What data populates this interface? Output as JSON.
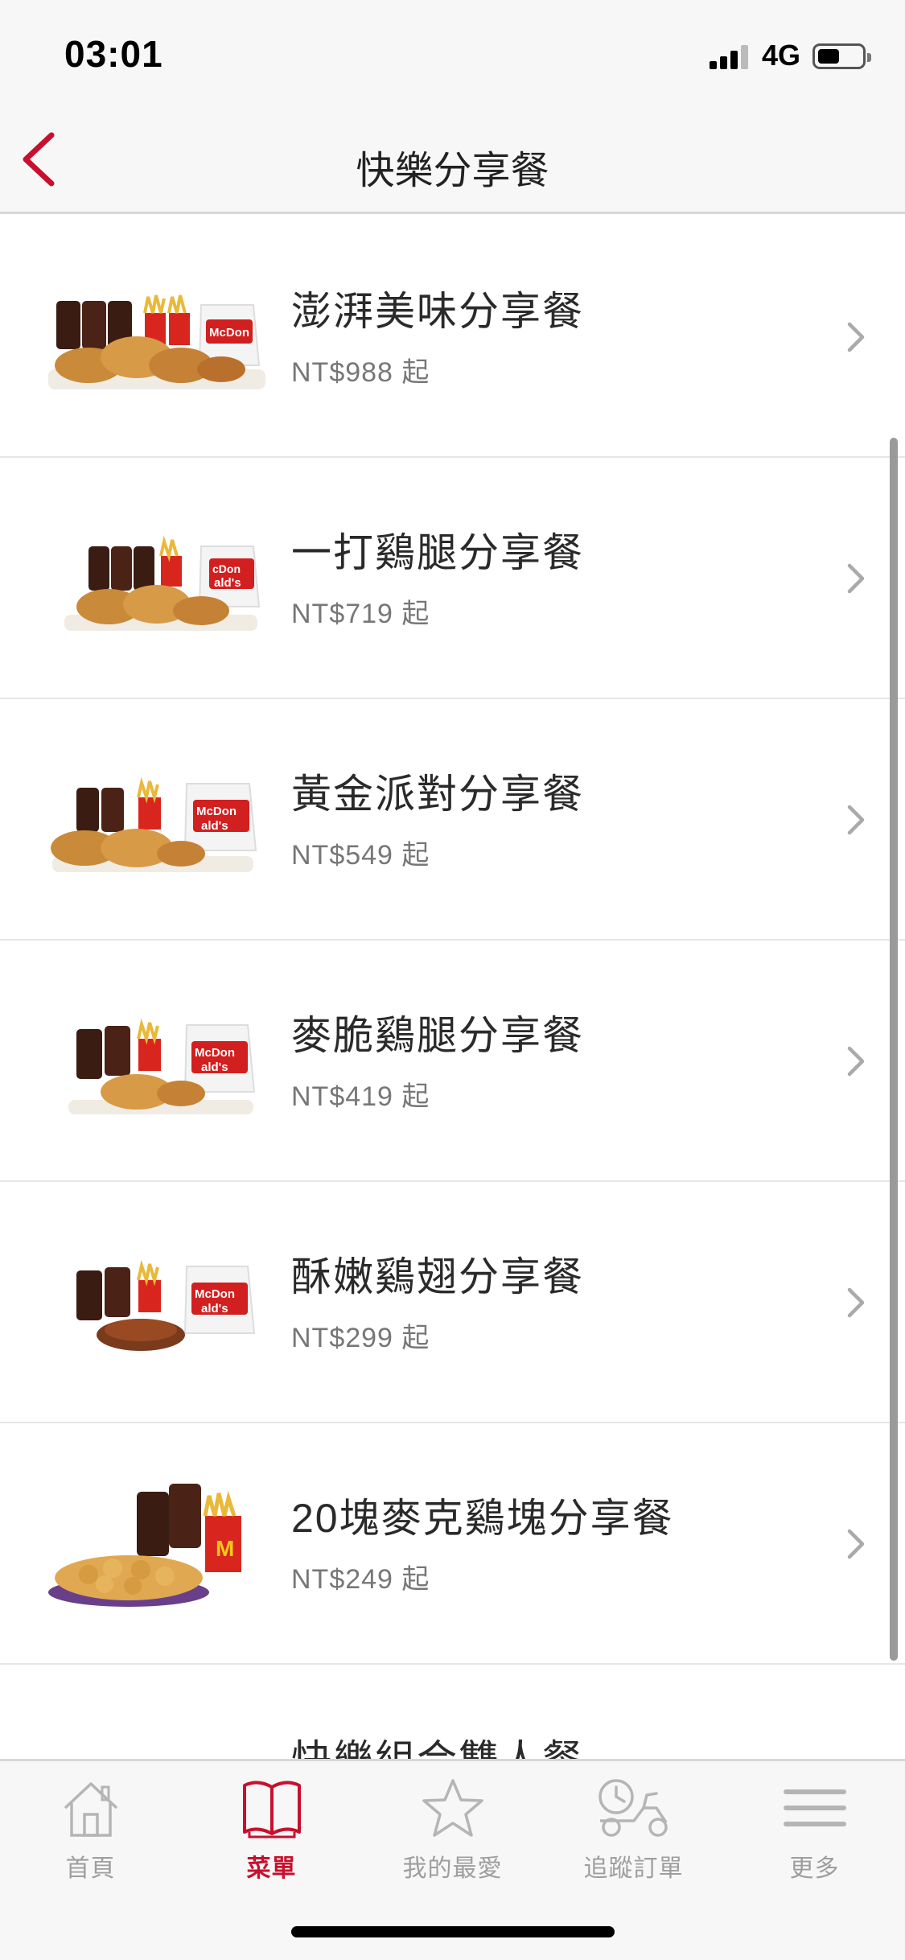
{
  "status_bar": {
    "time": "03:01",
    "network": "4G"
  },
  "nav": {
    "title": "快樂分享餐",
    "back_icon": "chevron-left-icon"
  },
  "items": [
    {
      "name": "澎湃美味分享餐",
      "price": "NT$988 起"
    },
    {
      "name": "一打鷄腿分享餐",
      "price": "NT$719 起"
    },
    {
      "name": "黃金派對分享餐",
      "price": "NT$549 起"
    },
    {
      "name": "麥脆鷄腿分享餐",
      "price": "NT$419 起"
    },
    {
      "name": "酥嫩鷄翅分享餐",
      "price": "NT$299 起"
    },
    {
      "name": "20塊麥克鷄塊分享餐",
      "price": "NT$249 起"
    },
    {
      "name": "快樂組合雙人餐",
      "price": ""
    }
  ],
  "tabbar": {
    "tabs": [
      {
        "label": "首頁",
        "icon": "home-icon",
        "active": false
      },
      {
        "label": "菜單",
        "icon": "menu-book-icon",
        "active": true
      },
      {
        "label": "我的最愛",
        "icon": "star-icon",
        "active": false
      },
      {
        "label": "追蹤訂單",
        "icon": "delivery-scooter-icon",
        "active": false
      },
      {
        "label": "更多",
        "icon": "hamburger-menu-icon",
        "active": false
      }
    ]
  },
  "colors": {
    "brand_red": "#c8102e",
    "inactive_gray": "#9e9e9e"
  }
}
